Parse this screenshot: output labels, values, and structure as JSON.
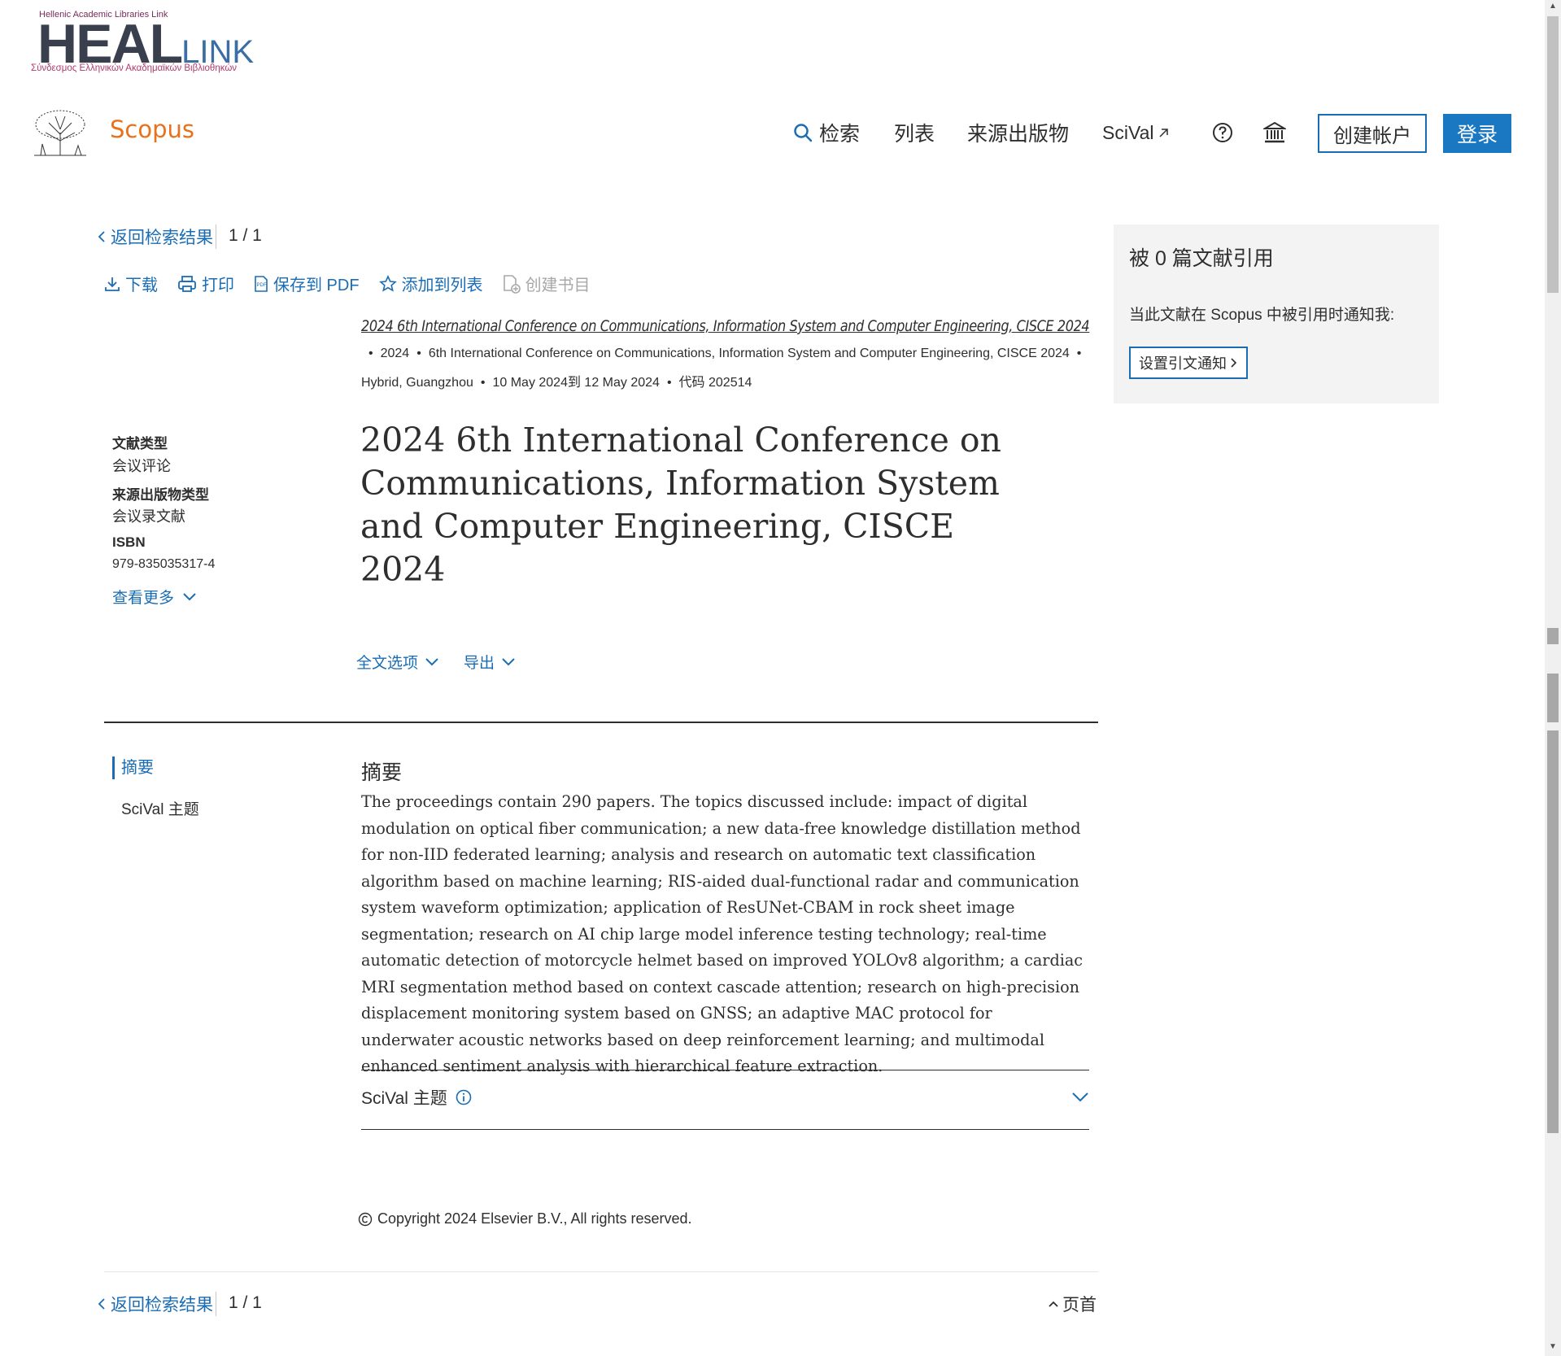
{
  "heal_logo": {
    "top_text": "Hellenic Academic Libraries Link",
    "big": "HEAL",
    "link_part": "LINK",
    "sub_text": "Σύνδεσμος Ελληνικών Ακαδημαϊκών Βιβλιοθηκών"
  },
  "header": {
    "brand": "Scopus",
    "nav": {
      "search": "检索",
      "lists": "列表",
      "sources": "来源出版物",
      "scival": "SciVal"
    },
    "create_account": "创建帐户",
    "login": "登录"
  },
  "breadcrumb": {
    "back": "返回检索结果",
    "pager": "1 / 1"
  },
  "toolbar": {
    "download": "下载",
    "print": "打印",
    "save_pdf": "保存到 PDF",
    "add_to_list": "添加到列表",
    "create_bib": "创建书目"
  },
  "source": {
    "conference_link": "2024 6th International Conference on Communications, Information System and Computer Engineering, CISCE 2024",
    "line1_year": "2024",
    "line1_conf": "6th International Conference on Communications, Information System and Computer Engineering, CISCE 2024",
    "line2_place": "Hybrid, Guangzhou",
    "line2_dates": "10 May 2024到 12 May 2024",
    "line2_code": "代码 202514"
  },
  "title": "2024 6th International Conference on Communications, Information System and Computer Engineering, CISCE 2024",
  "side_meta": {
    "doc_type_label": "文献类型",
    "doc_type_value": "会议评论",
    "source_type_label": "来源出版物类型",
    "source_type_value": "会议录文献",
    "isbn_label": "ISBN",
    "isbn_value": "979-835035317-4",
    "more": "查看更多"
  },
  "actions": {
    "full_text": "全文选项",
    "export": "导出"
  },
  "toc": {
    "abstract": "摘要",
    "scival": "SciVal 主题"
  },
  "abstract": {
    "heading": "摘要",
    "text": "The proceedings contain 290 papers. The topics discussed include: impact of digital modulation on optical fiber communication; a new data-free knowledge distillation method for non-IID federated learning; analysis and research on automatic text classification algorithm based on machine learning; RIS-aided dual-functional radar and communication system waveform optimization; application of ResUNet-CBAM in rock sheet image segmentation; research on AI chip large model inference testing technology; real-time automatic detection of motorcycle helmet based on improved YOLOv8 algorithm; a cardiac MRI segmentation method based on context cascade attention; research on high-precision displacement monitoring system based on GNSS; an adaptive MAC protocol for underwater acoustic networks based on deep reinforcement learning; and multimodal enhanced sentiment analysis with hierarchical feature extraction."
  },
  "scival_section": {
    "label": "SciVal 主题"
  },
  "copyright": "Copyright 2024 Elsevier B.V., All rights reserved.",
  "footer": {
    "back": "返回检索结果",
    "pager": "1 / 1",
    "top": "页首"
  },
  "cited_by": {
    "title": "被 0 篇文献引用",
    "desc": "当此文献在 Scopus 中被引用时通知我:",
    "button": "设置引文通知"
  },
  "colors": {
    "accent": "#1a6db5",
    "brand_orange": "#e9711c",
    "panel_bg": "#f3f3f3"
  }
}
